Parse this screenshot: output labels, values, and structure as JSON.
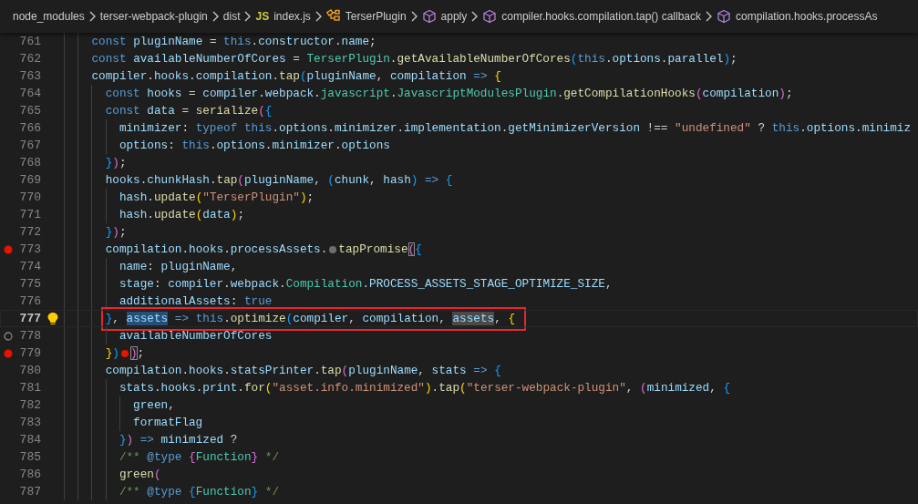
{
  "breadcrumb": [
    {
      "label": "node_modules",
      "kind": "folder"
    },
    {
      "label": "terser-webpack-plugin",
      "kind": "folder"
    },
    {
      "label": "dist",
      "kind": "folder"
    },
    {
      "label": "index.js",
      "kind": "file",
      "badge": "JS"
    },
    {
      "label": "TerserPlugin",
      "kind": "class"
    },
    {
      "label": "apply",
      "kind": "method"
    },
    {
      "label": "compiler.hooks.compilation.tap() callback",
      "kind": "method"
    },
    {
      "label": "compilation.hooks.processAs",
      "kind": "method"
    }
  ],
  "lines": [
    {
      "number": "761",
      "tokens": [
        {
          "text": "    const ",
          "kind": "keyword"
        },
        {
          "text": "pluginName",
          "kind": "variable"
        },
        {
          "text": " = ",
          "kind": "plain"
        },
        {
          "text": "this",
          "kind": "keyword"
        },
        {
          "text": ".",
          "kind": "plain"
        },
        {
          "text": "constructor",
          "kind": "variable"
        },
        {
          "text": ".",
          "kind": "plain"
        },
        {
          "text": "name",
          "kind": "variable"
        },
        {
          "text": ";",
          "kind": "plain"
        }
      ]
    },
    {
      "number": "762",
      "tokens": [
        {
          "text": "    const ",
          "kind": "keyword"
        },
        {
          "text": "availableNumberOfCores",
          "kind": "variable"
        },
        {
          "text": " = ",
          "kind": "plain"
        },
        {
          "text": "TerserPlugin",
          "kind": "type"
        },
        {
          "text": ".",
          "kind": "plain"
        },
        {
          "text": "getAvailableNumberOfCores",
          "kind": "function"
        },
        {
          "text": "(",
          "kind": "bracket3"
        },
        {
          "text": "this",
          "kind": "keyword"
        },
        {
          "text": ".",
          "kind": "plain"
        },
        {
          "text": "options",
          "kind": "variable"
        },
        {
          "text": ".",
          "kind": "plain"
        },
        {
          "text": "parallel",
          "kind": "variable"
        },
        {
          "text": ")",
          "kind": "bracket3"
        },
        {
          "text": ";",
          "kind": "plain"
        }
      ]
    },
    {
      "number": "763",
      "tokens": [
        {
          "text": "    compiler",
          "kind": "variable"
        },
        {
          "text": ".",
          "kind": "plain"
        },
        {
          "text": "hooks",
          "kind": "variable"
        },
        {
          "text": ".",
          "kind": "plain"
        },
        {
          "text": "compilation",
          "kind": "variable"
        },
        {
          "text": ".",
          "kind": "plain"
        },
        {
          "text": "tap",
          "kind": "function"
        },
        {
          "text": "(",
          "kind": "bracket3"
        },
        {
          "text": "pluginName",
          "kind": "variable"
        },
        {
          "text": ", ",
          "kind": "plain"
        },
        {
          "text": "compilation",
          "kind": "variable"
        },
        {
          "text": " => ",
          "kind": "keyword"
        },
        {
          "text": "{",
          "kind": "bracket1"
        }
      ]
    },
    {
      "number": "764",
      "tokens": [
        {
          "text": "      const ",
          "kind": "keyword"
        },
        {
          "text": "hooks",
          "kind": "variable"
        },
        {
          "text": " = ",
          "kind": "plain"
        },
        {
          "text": "compiler",
          "kind": "variable"
        },
        {
          "text": ".",
          "kind": "plain"
        },
        {
          "text": "webpack",
          "kind": "variable"
        },
        {
          "text": ".",
          "kind": "plain"
        },
        {
          "text": "javascript",
          "kind": "type"
        },
        {
          "text": ".",
          "kind": "plain"
        },
        {
          "text": "JavascriptModulesPlugin",
          "kind": "type"
        },
        {
          "text": ".",
          "kind": "plain"
        },
        {
          "text": "getCompilationHooks",
          "kind": "function"
        },
        {
          "text": "(",
          "kind": "bracket2"
        },
        {
          "text": "compilation",
          "kind": "variable"
        },
        {
          "text": ")",
          "kind": "bracket2"
        },
        {
          "text": ";",
          "kind": "plain"
        }
      ]
    },
    {
      "number": "765",
      "tokens": [
        {
          "text": "      const ",
          "kind": "keyword"
        },
        {
          "text": "data",
          "kind": "variable"
        },
        {
          "text": " = ",
          "kind": "plain"
        },
        {
          "text": "serialize",
          "kind": "function"
        },
        {
          "text": "(",
          "kind": "bracket2"
        },
        {
          "text": "{",
          "kind": "bracket3"
        }
      ]
    },
    {
      "number": "766",
      "tokens": [
        {
          "text": "        minimizer",
          "kind": "variable"
        },
        {
          "text": ": ",
          "kind": "plain"
        },
        {
          "text": "typeof this",
          "kind": "keyword"
        },
        {
          "text": ".",
          "kind": "plain"
        },
        {
          "text": "options",
          "kind": "variable"
        },
        {
          "text": ".",
          "kind": "plain"
        },
        {
          "text": "minimizer",
          "kind": "variable"
        },
        {
          "text": ".",
          "kind": "plain"
        },
        {
          "text": "implementation",
          "kind": "variable"
        },
        {
          "text": ".",
          "kind": "plain"
        },
        {
          "text": "getMinimizerVersion",
          "kind": "variable"
        },
        {
          "text": " !== ",
          "kind": "plain"
        },
        {
          "text": "\"undefined\"",
          "kind": "string"
        },
        {
          "text": " ? ",
          "kind": "plain"
        },
        {
          "text": "this",
          "kind": "keyword"
        },
        {
          "text": ".",
          "kind": "plain"
        },
        {
          "text": "options",
          "kind": "variable"
        },
        {
          "text": ".",
          "kind": "plain"
        },
        {
          "text": "minimiz",
          "kind": "variable"
        }
      ]
    },
    {
      "number": "767",
      "tokens": [
        {
          "text": "        options",
          "kind": "variable"
        },
        {
          "text": ": ",
          "kind": "plain"
        },
        {
          "text": "this",
          "kind": "keyword"
        },
        {
          "text": ".",
          "kind": "plain"
        },
        {
          "text": "options",
          "kind": "variable"
        },
        {
          "text": ".",
          "kind": "plain"
        },
        {
          "text": "minimizer",
          "kind": "variable"
        },
        {
          "text": ".",
          "kind": "plain"
        },
        {
          "text": "options",
          "kind": "variable"
        }
      ]
    },
    {
      "number": "768",
      "tokens": [
        {
          "text": "      }",
          "kind": "bracket3"
        },
        {
          "text": ")",
          "kind": "bracket2"
        },
        {
          "text": ";",
          "kind": "plain"
        }
      ]
    },
    {
      "number": "769",
      "tokens": [
        {
          "text": "      hooks",
          "kind": "variable"
        },
        {
          "text": ".",
          "kind": "plain"
        },
        {
          "text": "chunkHash",
          "kind": "variable"
        },
        {
          "text": ".",
          "kind": "plain"
        },
        {
          "text": "tap",
          "kind": "function"
        },
        {
          "text": "(",
          "kind": "bracket2"
        },
        {
          "text": "pluginName",
          "kind": "variable"
        },
        {
          "text": ", ",
          "kind": "plain"
        },
        {
          "text": "(",
          "kind": "bracket3"
        },
        {
          "text": "chunk",
          "kind": "variable"
        },
        {
          "text": ", ",
          "kind": "plain"
        },
        {
          "text": "hash",
          "kind": "variable"
        },
        {
          "text": ")",
          "kind": "bracket3"
        },
        {
          "text": " => ",
          "kind": "keyword"
        },
        {
          "text": "{",
          "kind": "bracket3"
        }
      ]
    },
    {
      "number": "770",
      "tokens": [
        {
          "text": "        hash",
          "kind": "variable"
        },
        {
          "text": ".",
          "kind": "plain"
        },
        {
          "text": "update",
          "kind": "function"
        },
        {
          "text": "(",
          "kind": "bracket1"
        },
        {
          "text": "\"TerserPlugin\"",
          "kind": "string"
        },
        {
          "text": ")",
          "kind": "bracket1"
        },
        {
          "text": ";",
          "kind": "plain"
        }
      ]
    },
    {
      "number": "771",
      "tokens": [
        {
          "text": "        hash",
          "kind": "variable"
        },
        {
          "text": ".",
          "kind": "plain"
        },
        {
          "text": "update",
          "kind": "function"
        },
        {
          "text": "(",
          "kind": "bracket1"
        },
        {
          "text": "data",
          "kind": "variable"
        },
        {
          "text": ")",
          "kind": "bracket1"
        },
        {
          "text": ";",
          "kind": "plain"
        }
      ]
    },
    {
      "number": "772",
      "tokens": [
        {
          "text": "      }",
          "kind": "bracket3"
        },
        {
          "text": ")",
          "kind": "bracket2"
        },
        {
          "text": ";",
          "kind": "plain"
        }
      ]
    },
    {
      "number": "773",
      "breakpoint": true,
      "tokens": [
        {
          "text": "      compilation",
          "kind": "variable"
        },
        {
          "text": ".",
          "kind": "plain"
        },
        {
          "text": "hooks",
          "kind": "variable"
        },
        {
          "text": ".",
          "kind": "plain"
        },
        {
          "text": "processAssets",
          "kind": "variable"
        },
        {
          "text": ".",
          "kind": "plain"
        },
        {
          "kind": "inline_breakpoint",
          "active": false
        },
        {
          "text": "tapPromise",
          "kind": "function"
        },
        {
          "text": "(",
          "kind": "bracket2",
          "bracket_match": true
        },
        {
          "text": "{",
          "kind": "bracket3"
        }
      ]
    },
    {
      "number": "774",
      "tokens": [
        {
          "text": "        name",
          "kind": "variable"
        },
        {
          "text": ": ",
          "kind": "plain"
        },
        {
          "text": "pluginName",
          "kind": "variable"
        },
        {
          "text": ",",
          "kind": "plain"
        }
      ]
    },
    {
      "number": "775",
      "tokens": [
        {
          "text": "        stage",
          "kind": "variable"
        },
        {
          "text": ": ",
          "kind": "plain"
        },
        {
          "text": "compiler",
          "kind": "variable"
        },
        {
          "text": ".",
          "kind": "plain"
        },
        {
          "text": "webpack",
          "kind": "variable"
        },
        {
          "text": ".",
          "kind": "plain"
        },
        {
          "text": "Compilation",
          "kind": "type"
        },
        {
          "text": ".",
          "kind": "plain"
        },
        {
          "text": "PROCESS_ASSETS_STAGE_OPTIMIZE_SIZE",
          "kind": "variable"
        },
        {
          "text": ",",
          "kind": "plain"
        }
      ]
    },
    {
      "number": "776",
      "tokens": [
        {
          "text": "        additionalAssets",
          "kind": "variable"
        },
        {
          "text": ": ",
          "kind": "plain"
        },
        {
          "text": "true",
          "kind": "keyword"
        }
      ]
    },
    {
      "number": "777",
      "current": true,
      "lightbulb": true,
      "boxed": true,
      "tokens": [
        {
          "text": "      }",
          "kind": "bracket3"
        },
        {
          "text": ", ",
          "kind": "plain"
        },
        {
          "text": "assets",
          "kind": "variable",
          "selected": true
        },
        {
          "text": " => this",
          "kind": "keyword"
        },
        {
          "text": ".",
          "kind": "plain"
        },
        {
          "text": "optimize",
          "kind": "function"
        },
        {
          "text": "(",
          "kind": "bracket3"
        },
        {
          "text": "compiler",
          "kind": "variable"
        },
        {
          "text": ", ",
          "kind": "plain"
        },
        {
          "text": "compilation",
          "kind": "variable"
        },
        {
          "text": ", ",
          "kind": "plain"
        },
        {
          "text": "assets",
          "kind": "variable",
          "occurrence": true
        },
        {
          "text": ", ",
          "kind": "plain"
        },
        {
          "text": "{",
          "kind": "bracket1"
        }
      ]
    },
    {
      "number": "778",
      "breakpoint": true,
      "unverified": true,
      "tokens": [
        {
          "text": "        availableNumberOfCores",
          "kind": "variable"
        }
      ]
    },
    {
      "number": "779",
      "breakpoint": true,
      "tokens": [
        {
          "text": "      }",
          "kind": "bracket1"
        },
        {
          "text": ")",
          "kind": "bracket3"
        },
        {
          "kind": "inline_breakpoint",
          "active": true
        },
        {
          "text": ")",
          "kind": "bracket2",
          "bracket_match": true
        },
        {
          "text": ";",
          "kind": "plain"
        }
      ]
    },
    {
      "number": "780",
      "tokens": [
        {
          "text": "      compilation",
          "kind": "variable"
        },
        {
          "text": ".",
          "kind": "plain"
        },
        {
          "text": "hooks",
          "kind": "variable"
        },
        {
          "text": ".",
          "kind": "plain"
        },
        {
          "text": "statsPrinter",
          "kind": "variable"
        },
        {
          "text": ".",
          "kind": "plain"
        },
        {
          "text": "tap",
          "kind": "function"
        },
        {
          "text": "(",
          "kind": "bracket2"
        },
        {
          "text": "pluginName",
          "kind": "variable"
        },
        {
          "text": ", ",
          "kind": "plain"
        },
        {
          "text": "stats",
          "kind": "variable"
        },
        {
          "text": " => ",
          "kind": "keyword"
        },
        {
          "text": "{",
          "kind": "bracket3"
        }
      ]
    },
    {
      "number": "781",
      "tokens": [
        {
          "text": "        stats",
          "kind": "variable"
        },
        {
          "text": ".",
          "kind": "plain"
        },
        {
          "text": "hooks",
          "kind": "variable"
        },
        {
          "text": ".",
          "kind": "plain"
        },
        {
          "text": "print",
          "kind": "variable"
        },
        {
          "text": ".",
          "kind": "plain"
        },
        {
          "text": "for",
          "kind": "function"
        },
        {
          "text": "(",
          "kind": "bracket1"
        },
        {
          "text": "\"asset.info.minimized\"",
          "kind": "string"
        },
        {
          "text": ")",
          "kind": "bracket1"
        },
        {
          "text": ".",
          "kind": "plain"
        },
        {
          "text": "tap",
          "kind": "function"
        },
        {
          "text": "(",
          "kind": "bracket1"
        },
        {
          "text": "\"terser-webpack-plugin\"",
          "kind": "string"
        },
        {
          "text": ", ",
          "kind": "plain"
        },
        {
          "text": "(",
          "kind": "bracket2"
        },
        {
          "text": "minimized",
          "kind": "variable"
        },
        {
          "text": ", ",
          "kind": "plain"
        },
        {
          "text": "{",
          "kind": "bracket3"
        }
      ]
    },
    {
      "number": "782",
      "tokens": [
        {
          "text": "          green",
          "kind": "variable"
        },
        {
          "text": ",",
          "kind": "plain"
        }
      ]
    },
    {
      "number": "783",
      "tokens": [
        {
          "text": "          formatFlag",
          "kind": "variable"
        }
      ]
    },
    {
      "number": "784",
      "tokens": [
        {
          "text": "        }",
          "kind": "bracket3"
        },
        {
          "text": ")",
          "kind": "bracket2"
        },
        {
          "text": " => ",
          "kind": "keyword"
        },
        {
          "text": "minimized",
          "kind": "variable"
        },
        {
          "text": " ?",
          "kind": "plain"
        }
      ]
    },
    {
      "number": "785",
      "tokens": [
        {
          "text": "        /** ",
          "kind": "comment"
        },
        {
          "text": "@type ",
          "kind": "keyword"
        },
        {
          "text": "{",
          "kind": "bracket2"
        },
        {
          "text": "Function",
          "kind": "type"
        },
        {
          "text": "}",
          "kind": "bracket2"
        },
        {
          "text": " */",
          "kind": "comment"
        }
      ]
    },
    {
      "number": "786",
      "tokens": [
        {
          "text": "        green",
          "kind": "function"
        },
        {
          "text": "(",
          "kind": "bracket2"
        }
      ]
    },
    {
      "number": "787",
      "tokens": [
        {
          "text": "        /** ",
          "kind": "comment"
        },
        {
          "text": "@type ",
          "kind": "keyword"
        },
        {
          "text": "{",
          "kind": "bracket3"
        },
        {
          "text": "Function",
          "kind": "type"
        },
        {
          "text": "}",
          "kind": "bracket3"
        },
        {
          "text": " */",
          "kind": "comment"
        }
      ]
    }
  ]
}
